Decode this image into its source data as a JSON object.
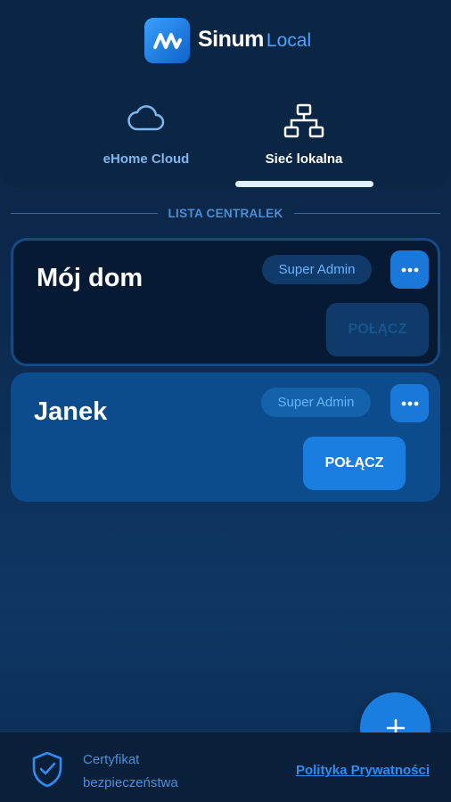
{
  "app": {
    "name_main": "Sinum",
    "name_sub": "Local"
  },
  "tabs": [
    {
      "label": "eHome Cloud",
      "icon": "cloud-icon",
      "active": false
    },
    {
      "label": "Sieć lokalna",
      "icon": "network-icon",
      "active": true
    }
  ],
  "section": {
    "title": "LISTA CENTRALEK"
  },
  "devices": [
    {
      "name": "Mój dom",
      "role": "Super Admin",
      "connect_label": "POŁĄCZ",
      "connect_enabled": false
    },
    {
      "name": "Janek",
      "role": "Super Admin",
      "connect_label": "POŁĄCZ",
      "connect_enabled": true
    }
  ],
  "fab": {
    "icon": "plus-icon"
  },
  "footer": {
    "cert_line1": "Certyfikat",
    "cert_line2": "bezpieczeństwa",
    "privacy_label": "Polityka Prywatności"
  },
  "colors": {
    "accent": "#1a7ee0",
    "background": "#0a2342",
    "link": "#2f8cf0"
  }
}
